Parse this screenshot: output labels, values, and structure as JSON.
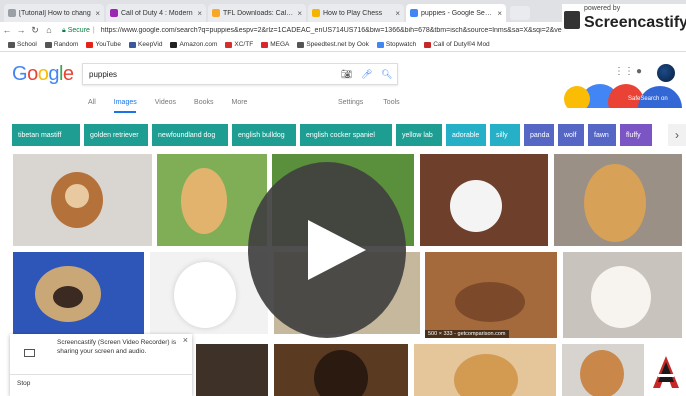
{
  "tabs": [
    {
      "title": "[Tutorial] How to chang",
      "fav": "#9aa0a6",
      "active": false
    },
    {
      "title": "Call of Duty 4 : Modern",
      "fav": "#9c27b0",
      "active": false
    },
    {
      "title": "TFL Downloads: Call of",
      "fav": "#f9a825",
      "active": false
    },
    {
      "title": "How to Play Chess",
      "fav": "#f5b400",
      "active": false
    },
    {
      "title": "puppies - Google Search",
      "fav": "#4285f4",
      "active": true
    }
  ],
  "toolbar": {
    "secure_label": "Secure",
    "url": "https://www.google.com/search?q=puppies&espv=2&rlz=1CADEAC_enUS714US716&biw=1366&bih=678&tbm=isch&source=lnms&sa=X&sqi=2&ved=..."
  },
  "bookmarks": [
    {
      "label": "School",
      "color": "#555"
    },
    {
      "label": "Random",
      "color": "#555"
    },
    {
      "label": "YouTube",
      "color": "#e62117"
    },
    {
      "label": "KeepVid",
      "color": "#3b5998"
    },
    {
      "label": "Amazon.com",
      "color": "#222"
    },
    {
      "label": "XC/TF",
      "color": "#d32f2f"
    },
    {
      "label": "MEGA",
      "color": "#d9272e"
    },
    {
      "label": "Speedtest.net by Ook",
      "color": "#555"
    },
    {
      "label": "Stopwatch",
      "color": "#4285f4"
    },
    {
      "label": "Call of Duty®4 Mod",
      "color": "#c62828"
    }
  ],
  "brand": {
    "powered_by": "powered by",
    "name": "Screencastify Lit"
  },
  "google": {
    "logo_letters": [
      {
        "ch": "G",
        "color": "#4285f4"
      },
      {
        "ch": "o",
        "color": "#ea4335"
      },
      {
        "ch": "o",
        "color": "#fbbc05"
      },
      {
        "ch": "g",
        "color": "#4285f4"
      },
      {
        "ch": "l",
        "color": "#34a853"
      },
      {
        "ch": "e",
        "color": "#ea4335"
      }
    ],
    "query": "puppies",
    "safesearch_label": "SafeSearch on"
  },
  "result_tabs": {
    "items": [
      "All",
      "Images",
      "Videos",
      "Books",
      "More"
    ],
    "active": "Images"
  },
  "result_tools": [
    "Settings",
    "Tools"
  ],
  "chips": [
    {
      "label": "tibetan mastiff",
      "color": "#1e9e93"
    },
    {
      "label": "golden retriever",
      "color": "#1e9e93"
    },
    {
      "label": "newfoundland dog",
      "color": "#1e9e93"
    },
    {
      "label": "english bulldog",
      "color": "#1e9e93"
    },
    {
      "label": "english cocker spaniel",
      "color": "#1e9e93"
    },
    {
      "label": "yellow lab",
      "color": "#1e9e93"
    },
    {
      "label": "adorable",
      "color": "#25b0c7"
    },
    {
      "label": "silly",
      "color": "#25b0c7"
    },
    {
      "label": "panda",
      "color": "#5566c4"
    },
    {
      "label": "wolf",
      "color": "#5566c4"
    },
    {
      "label": "fawn",
      "color": "#5566c4"
    },
    {
      "label": "fluffy",
      "color": "#7c55c4"
    }
  ],
  "image_caption": "500 × 333 - getcomparison.com",
  "notification": {
    "text": "Screencastify (Screen Video Recorder) is sharing your screen and audio.",
    "stop_label": "Stop"
  }
}
